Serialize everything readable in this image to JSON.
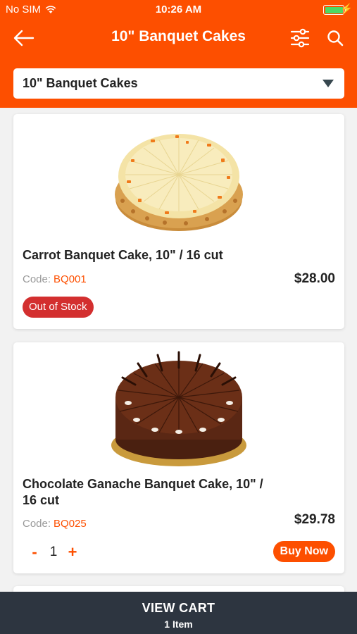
{
  "status_bar": {
    "carrier": "No SIM",
    "time": "10:26 AM"
  },
  "nav": {
    "title": "10\" Banquet Cakes"
  },
  "category_dropdown": {
    "selected": "10\" Banquet Cakes"
  },
  "products": [
    {
      "name": "Carrot Banquet Cake, 10\" / 16 cut",
      "code_label": "Code:",
      "code": "BQ001",
      "price": "$28.00",
      "stock_badge": "Out of Stock"
    },
    {
      "name": "Chocolate Ganache Banquet Cake, 10\" / 16 cut",
      "code_label": "Code:",
      "code": "BQ025",
      "price": "$29.78",
      "quantity": "1",
      "minus_label": "-",
      "plus_label": "+",
      "buy_label": "Buy Now"
    }
  ],
  "cart": {
    "label": "VIEW CART",
    "count": "1 Item"
  },
  "colors": {
    "brand": "#fd4f00",
    "badge": "#d32f2f",
    "cart_bar": "#2d3540"
  }
}
